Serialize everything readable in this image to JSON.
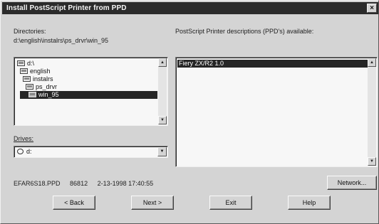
{
  "window": {
    "title": "Install PostScript Printer from PPD",
    "close_glyph": "×"
  },
  "directories": {
    "label": "Directories:",
    "current_path": "d:\\english\\instalrs\\ps_drvr\\win_95",
    "items": [
      {
        "label": "d:\\",
        "icon": "open-folder-icon",
        "selected": false
      },
      {
        "label": "english",
        "icon": "open-folder-icon",
        "selected": false
      },
      {
        "label": "instalrs",
        "icon": "open-folder-icon",
        "selected": false
      },
      {
        "label": "ps_drvr",
        "icon": "open-folder-icon",
        "selected": false
      },
      {
        "label": "win_95",
        "icon": "open-folder-icon",
        "selected": true
      }
    ]
  },
  "drives": {
    "label": "Drives:",
    "value": "d:",
    "icon": "drive-icon"
  },
  "ppd_list": {
    "label": "PostScript Printer descriptions (PPD's) available:",
    "items": [
      "Fiery ZX/R2 1.0"
    ]
  },
  "status": {
    "filename": "EFAR6S18.PPD",
    "size": "86812",
    "datetime": "2-13-1998 17:40:55"
  },
  "buttons": {
    "network": "Network...",
    "back": "< Back",
    "next": "Next >",
    "exit": "Exit",
    "help": "Help"
  }
}
